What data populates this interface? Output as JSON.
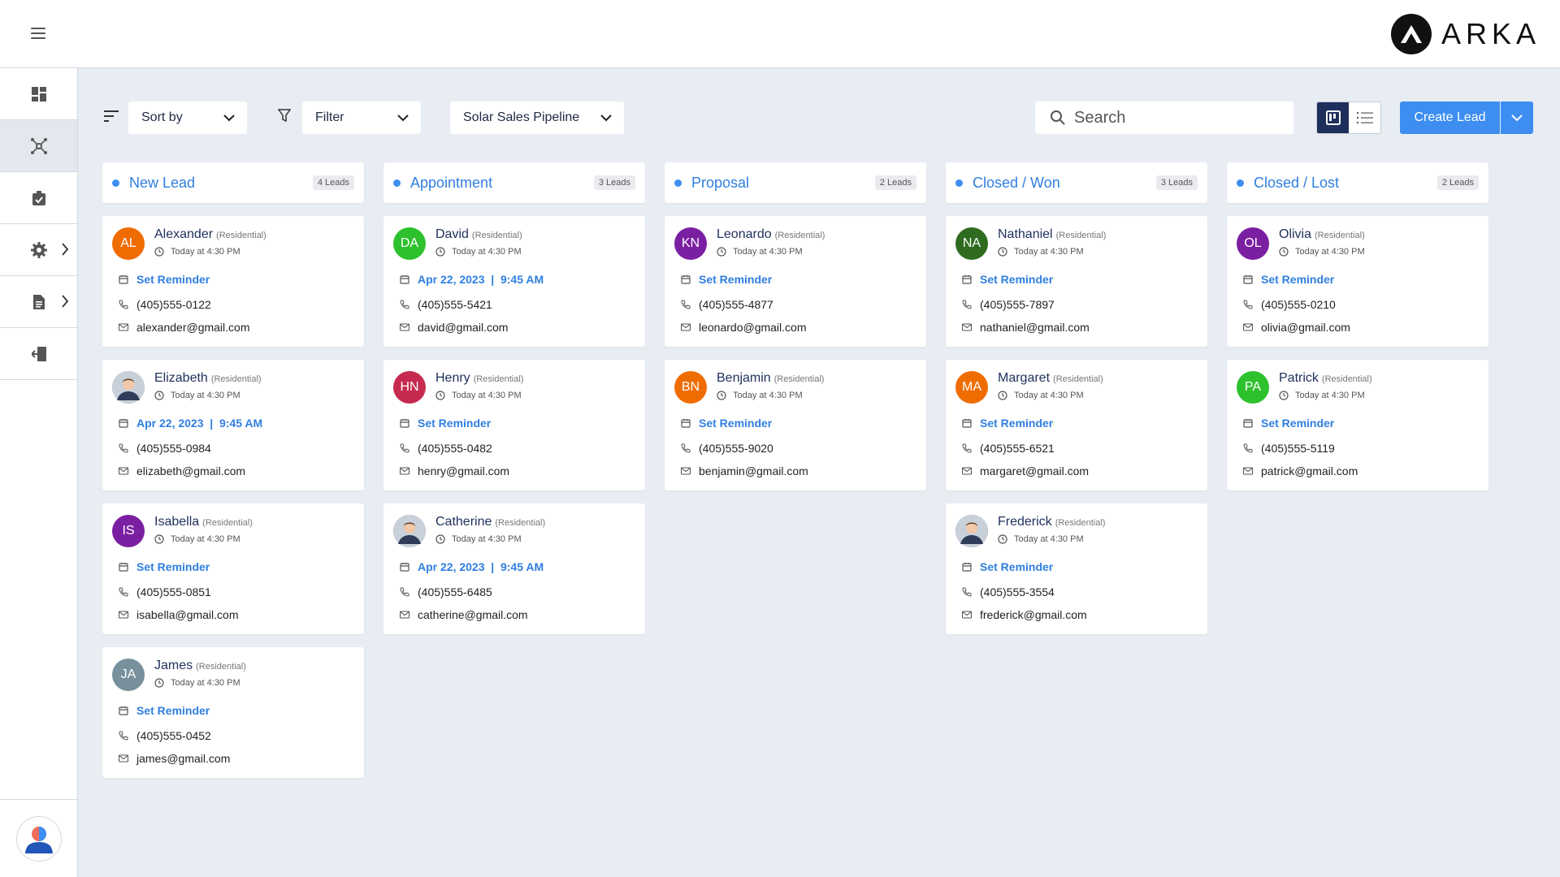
{
  "app": {
    "brand": "ARKA"
  },
  "toolbar": {
    "sort_label": "Sort by",
    "filter_label": "Filter",
    "pipeline_label": "Solar Sales Pipeline",
    "search_placeholder": "Search",
    "create_label": "Create Lead"
  },
  "colors": {
    "accent": "#3d8ef0",
    "navy": "#1f2f5c"
  },
  "columns": [
    {
      "title": "New Lead",
      "count": "4 Leads"
    },
    {
      "title": "Appointment",
      "count": "3 Leads"
    },
    {
      "title": "Proposal",
      "count": "2 Leads"
    },
    {
      "title": "Closed / Won",
      "count": "3 Leads"
    },
    {
      "title": "Closed / Lost",
      "count": "2 Leads"
    }
  ],
  "cards": [
    [
      {
        "initials": "AL",
        "color": "#ef6c00",
        "name": "Alexander",
        "type": "(Residential)",
        "time": "Today at 4:30 PM",
        "reminder": "Set Reminder",
        "phone": "(405)555-0122",
        "email": "alexander@gmail.com"
      },
      {
        "initials": "",
        "photo": true,
        "color": "#5b7bb4",
        "name": "Elizabeth",
        "type": "(Residential)",
        "time": "Today at 4:30 PM",
        "reminder": "Apr 22, 2023  |  9:45 AM",
        "phone": "(405)555-0984",
        "email": "elizabeth@gmail.com"
      },
      {
        "initials": "IS",
        "color": "#7b1fa2",
        "name": "Isabella",
        "type": "(Residential)",
        "time": "Today at 4:30 PM",
        "reminder": "Set Reminder",
        "phone": "(405)555-0851",
        "email": "isabella@gmail.com"
      },
      {
        "initials": "JA",
        "color": "#78909c",
        "name": "James",
        "type": "(Residential)",
        "time": "Today at 4:30 PM",
        "reminder": "Set Reminder",
        "phone": "(405)555-0452",
        "email": "james@gmail.com"
      }
    ],
    [
      {
        "initials": "DA",
        "color": "#2ec12e",
        "name": "David",
        "type": "(Residential)",
        "time": "Today at 4:30 PM",
        "reminder": "Apr 22, 2023  |  9:45 AM",
        "phone": "(405)555-5421",
        "email": "david@gmail.com"
      },
      {
        "initials": "HN",
        "color": "#c62a4f",
        "name": "Henry",
        "type": "(Residential)",
        "time": "Today at 4:30 PM",
        "reminder": "Set Reminder",
        "phone": "(405)555-0482",
        "email": "henry@gmail.com"
      },
      {
        "initials": "",
        "photo": true,
        "color": "#8d6e63",
        "name": "Catherine",
        "type": "(Residential)",
        "time": "Today at 4:30 PM",
        "reminder": "Apr 22, 2023  |  9:45 AM",
        "phone": "(405)555-6485",
        "email": "catherine@gmail.com"
      }
    ],
    [
      {
        "initials": "KN",
        "color": "#7b1fa2",
        "name": "Leonardo",
        "type": "(Residential)",
        "time": "Today at 4:30 PM",
        "reminder": "Set Reminder",
        "phone": "(405)555-4877",
        "email": "leonardo@gmail.com"
      },
      {
        "initials": "BN",
        "color": "#ef6c00",
        "name": "Benjamin",
        "type": "(Residential)",
        "time": "Today at 4:30 PM",
        "reminder": "Set Reminder",
        "phone": "(405)555-9020",
        "email": "benjamin@gmail.com"
      }
    ],
    [
      {
        "initials": "NA",
        "color": "#2e6b1f",
        "name": "Nathaniel",
        "type": "(Residential)",
        "time": "Today at 4:30 PM",
        "reminder": "Set Reminder",
        "phone": "(405)555-7897",
        "email": "nathaniel@gmail.com"
      },
      {
        "initials": "MA",
        "color": "#ef6c00",
        "name": "Margaret",
        "type": "(Residential)",
        "time": "Today at 4:30 PM",
        "reminder": "Set Reminder",
        "phone": "(405)555-6521",
        "email": "margaret@gmail.com"
      },
      {
        "initials": "",
        "photo": true,
        "color": "#6d4c41",
        "name": "Frederick",
        "type": "(Residential)",
        "time": "Today at 4:30 PM",
        "reminder": "Set Reminder",
        "phone": "(405)555-3554",
        "email": "frederick@gmail.com"
      }
    ],
    [
      {
        "initials": "OL",
        "color": "#7b1fa2",
        "name": "Olivia",
        "type": "(Residential)",
        "time": "Today at 4:30 PM",
        "reminder": "Set Reminder",
        "phone": "(405)555-0210",
        "email": "olivia@gmail.com"
      },
      {
        "initials": "PA",
        "color": "#2ec12e",
        "name": "Patrick",
        "type": "(Residential)",
        "time": "Today at 4:30 PM",
        "reminder": "Set Reminder",
        "phone": "(405)555-5119",
        "email": "patrick@gmail.com"
      }
    ]
  ]
}
